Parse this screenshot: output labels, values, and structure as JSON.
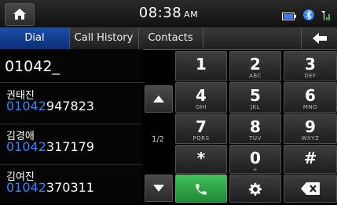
{
  "status": {
    "time": "08:38",
    "ampm": "AM"
  },
  "tabs": [
    {
      "label": "Dial",
      "active": true
    },
    {
      "label": "Call History",
      "active": false
    },
    {
      "label": "Contacts",
      "active": false
    }
  ],
  "dial_input": "01042_",
  "contacts": [
    {
      "name": "권태진",
      "match": "01042",
      "rest": "947823"
    },
    {
      "name": "김경애",
      "match": "01042",
      "rest": "317179"
    },
    {
      "name": "김여진",
      "match": "01042",
      "rest": "370311"
    }
  ],
  "page_indicator": "1/2",
  "keypad": {
    "keys": [
      {
        "digit": "1",
        "letters": ""
      },
      {
        "digit": "2",
        "letters": "ABC"
      },
      {
        "digit": "3",
        "letters": "DEF"
      },
      {
        "digit": "4",
        "letters": "GHI"
      },
      {
        "digit": "5",
        "letters": "JKL"
      },
      {
        "digit": "6",
        "letters": "MNO"
      },
      {
        "digit": "7",
        "letters": "PQRS"
      },
      {
        "digit": "8",
        "letters": "TUV"
      },
      {
        "digit": "9",
        "letters": "WXYZ"
      },
      {
        "digit": "*",
        "letters": ""
      },
      {
        "digit": "0",
        "letters": "+"
      },
      {
        "digit": "#",
        "letters": ""
      }
    ],
    "action_icons": [
      "call-icon",
      "settings-icon",
      "backspace-icon"
    ]
  },
  "colors": {
    "accent_blue": "#2f86ff",
    "call_green": "#2fa84a",
    "tab_active": "#1a4fa8"
  }
}
